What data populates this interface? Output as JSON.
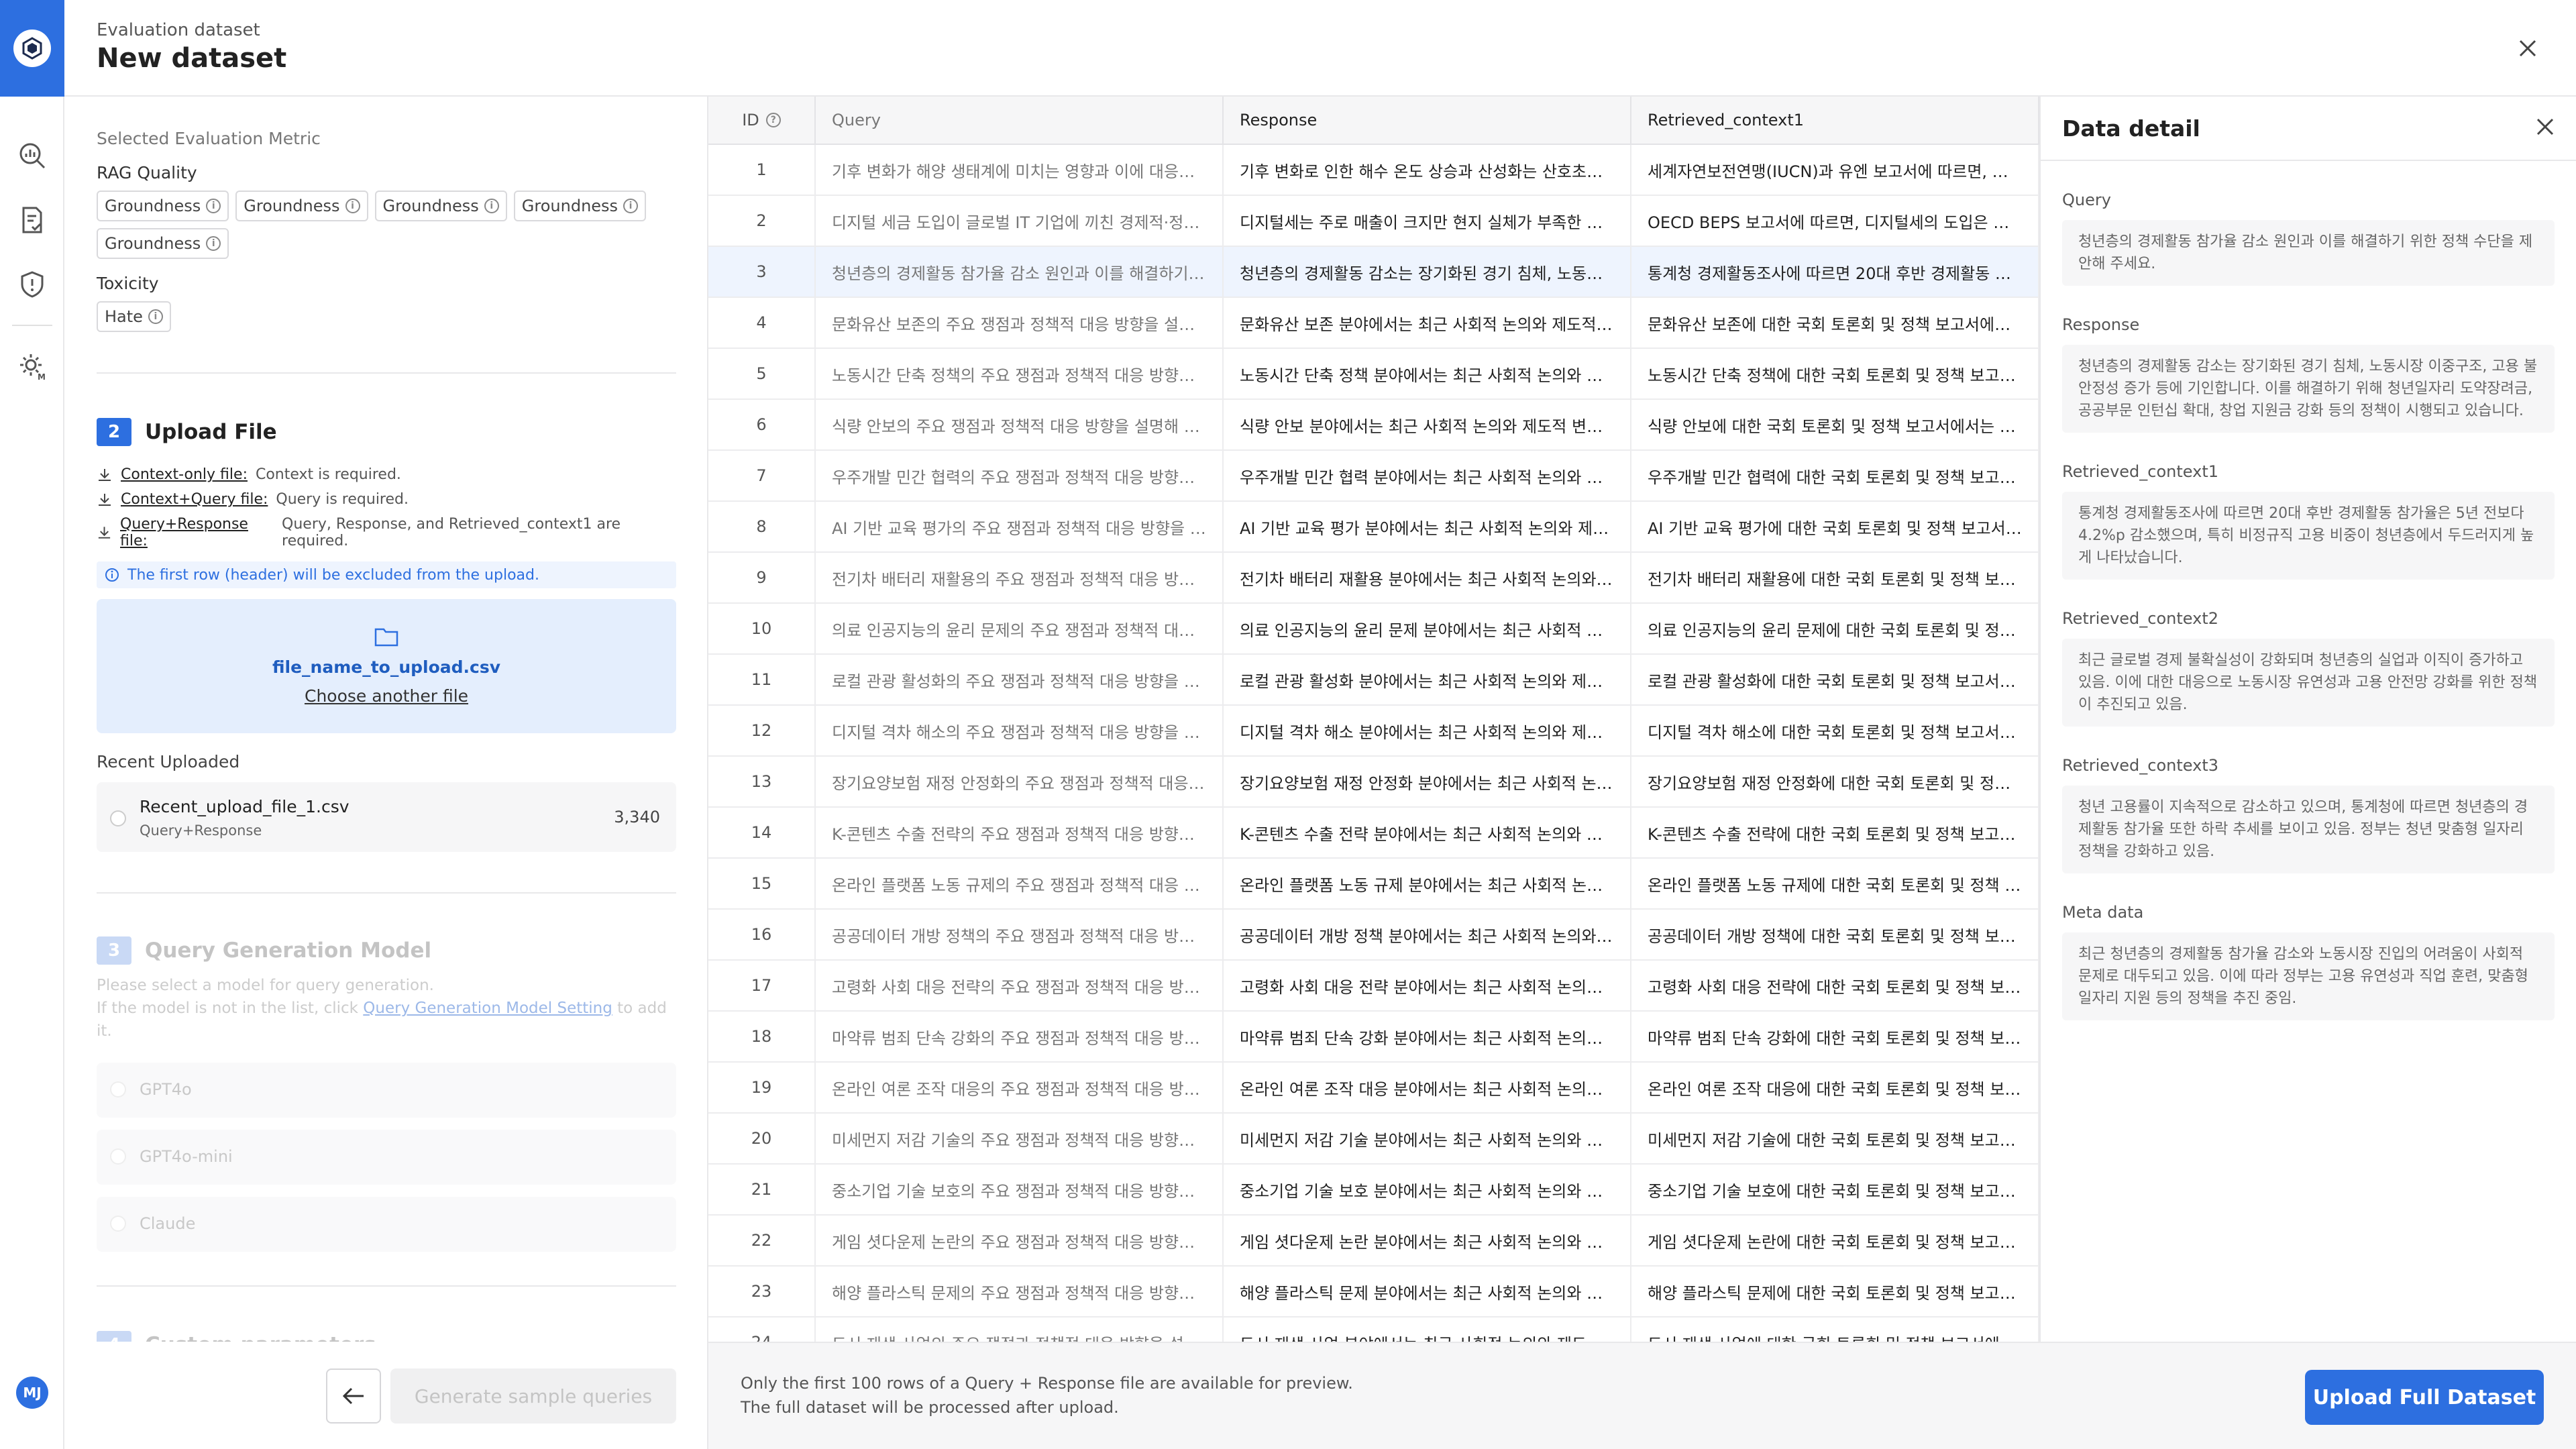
{
  "header": {
    "subtitle": "Evaluation dataset",
    "title": "New dataset"
  },
  "sidebar": {
    "avatar_initials": "MJ",
    "icons": [
      "analytics-icon",
      "document-check-icon",
      "shield-icon",
      "settings-model-icon"
    ]
  },
  "metrics": {
    "section_label": "Selected Evaluation Metric",
    "groups": [
      {
        "label": "RAG Quality",
        "chips": [
          "Groundness",
          "Groundness",
          "Groundness",
          "Groundness",
          "Groundness"
        ]
      },
      {
        "label": "Toxicity",
        "chips": [
          "Hate"
        ]
      }
    ]
  },
  "upload": {
    "step": "2",
    "title": "Upload File",
    "requirements": [
      {
        "link": "Context-only file:",
        "text": "Context is required."
      },
      {
        "link": "Context+Query file:",
        "text": "Query is required."
      },
      {
        "link": "Query+Response file:",
        "text": "Query, Response, and Retrieved_context1 are required."
      }
    ],
    "notice": "The first row (header) will be excluded from the upload.",
    "file_name": "file_name_to_upload.csv",
    "choose_another": "Choose another file",
    "recent_label": "Recent Uploaded",
    "recent": {
      "name": "Recent_upload_file_1.csv",
      "type": "Query+Response",
      "count": "3,340"
    }
  },
  "query_gen": {
    "step": "3",
    "title": "Query Generation Model",
    "desc1": "Please select a model for query generation.",
    "desc2_prefix": "If the model is not in the list, click ",
    "desc2_link": "Query Generation Model Setting",
    "desc2_suffix": " to add it.",
    "models": [
      "GPT4o",
      "GPT4o-mini",
      "Claude"
    ]
  },
  "custom": {
    "step": "4",
    "title": "Custom parameters"
  },
  "footer_left": {
    "generate_label": "Generate sample queries"
  },
  "table": {
    "columns": [
      "ID",
      "Query",
      "Response",
      "Retrieved_context1"
    ],
    "rows": [
      [
        "1",
        "기후 변화가 해양 생태계에 미치는 영향과 이에 대응하기 위한 정책",
        "기후 변화로 인한 해수 온도 상승과 산성화는 산호초의 백화를",
        "세계자연보전연맹(IUCN)과 유엔 보고서에 따르면, 해양 생태계"
      ],
      [
        "2",
        "디지털 세금 도입이 글로벌 IT 기업에 끼친 경제적·정책적 영향",
        "디지털세는 주로 매출이 크지만 현지 실체가 부족한 글로벌 기업",
        "OECD BEPS 보고서에 따르면, 디지털세의 도입은 다국적 기업"
      ],
      [
        "3",
        "청년층의 경제활동 참가율 감소 원인과 이를 해결하기 위한 정책",
        "청년층의 경제활동 감소는 장기화된 경기 침체, 노동시장 이중구조",
        "통계청 경제활동조사에 따르면 20대 후반 경제활동 참가율은"
      ],
      [
        "4",
        "문화유산 보존의 주요 쟁점과 정책적 대응 방향을 설명해 주세요",
        "문화유산 보존 분야에서는 최근 사회적 논의와 제도적 변화가",
        "문화유산 보존에 대한 국회 토론회 및 정책 보고서에서는"
      ],
      [
        "5",
        "노동시간 단축 정책의 주요 쟁점과 정책적 대응 방향을 설명해",
        "노동시간 단축 정책 분야에서는 최근 사회적 논의와 제도적",
        "노동시간 단축 정책에 대한 국회 토론회 및 정책 보고서에서는"
      ],
      [
        "6",
        "식량 안보의 주요 쟁점과 정책적 대응 방향을 설명해 주세요",
        "식량 안보 분야에서는 최근 사회적 논의와 제도적 변화가",
        "식량 안보에 대한 국회 토론회 및 정책 보고서에서는 관련"
      ],
      [
        "7",
        "우주개발 민간 협력의 주요 쟁점과 정책적 대응 방향을 설명해",
        "우주개발 민간 협력 분야에서는 최근 사회적 논의와 제도적",
        "우주개발 민간 협력에 대한 국회 토론회 및 정책 보고서에서는"
      ],
      [
        "8",
        "AI 기반 교육 평가의 주요 쟁점과 정책적 대응 방향을 설명해",
        "AI 기반 교육 평가 분야에서는 최근 사회적 논의와 제도적",
        "AI 기반 교육 평가에 대한 국회 토론회 및 정책 보고서에서는"
      ],
      [
        "9",
        "전기차 배터리 재활용의 주요 쟁점과 정책적 대응 방향을 설명해",
        "전기차 배터리 재활용 분야에서는 최근 사회적 논의와 제도적",
        "전기차 배터리 재활용에 대한 국회 토론회 및 정책 보고서에서는"
      ],
      [
        "10",
        "의료 인공지능의 윤리 문제의 주요 쟁점과 정책적 대응 방향을",
        "의료 인공지능의 윤리 문제 분야에서는 최근 사회적 논의와",
        "의료 인공지능의 윤리 문제에 대한 국회 토론회 및 정책 보고서"
      ],
      [
        "11",
        "로컬 관광 활성화의 주요 쟁점과 정책적 대응 방향을 설명해",
        "로컬 관광 활성화 분야에서는 최근 사회적 논의와 제도적 변화",
        "로컬 관광 활성화에 대한 국회 토론회 및 정책 보고서에서는"
      ],
      [
        "12",
        "디지털 격차 해소의 주요 쟁점과 정책적 대응 방향을 설명해",
        "디지털 격차 해소 분야에서는 최근 사회적 논의와 제도적 변화",
        "디지털 격차 해소에 대한 국회 토론회 및 정책 보고서에서는"
      ],
      [
        "13",
        "장기요양보험 재정 안정화의 주요 쟁점과 정책적 대응 방향을",
        "장기요양보험 재정 안정화 분야에서는 최근 사회적 논의와",
        "장기요양보험 재정 안정화에 대한 국회 토론회 및 정책 보고서"
      ],
      [
        "14",
        "K-콘텐츠 수출 전략의 주요 쟁점과 정책적 대응 방향을 설명해",
        "K-콘텐츠 수출 전략 분야에서는 최근 사회적 논의와 제도적",
        "K-콘텐츠 수출 전략에 대한 국회 토론회 및 정책 보고서에서는"
      ],
      [
        "15",
        "온라인 플랫폼 노동 규제의 주요 쟁점과 정책적 대응 방향을",
        "온라인 플랫폼 노동 규제 분야에서는 최근 사회적 논의와 제도적",
        "온라인 플랫폼 노동 규제에 대한 국회 토론회 및 정책 보고서"
      ],
      [
        "16",
        "공공데이터 개방 정책의 주요 쟁점과 정책적 대응 방향을 설명해",
        "공공데이터 개방 정책 분야에서는 최근 사회적 논의와 제도적",
        "공공데이터 개방 정책에 대한 국회 토론회 및 정책 보고서에서는"
      ],
      [
        "17",
        "고령화 사회 대응 전략의 주요 쟁점과 정책적 대응 방향을 설명해",
        "고령화 사회 대응 전략 분야에서는 최근 사회적 논의와 제도적",
        "고령화 사회 대응 전략에 대한 국회 토론회 및 정책 보고서에서는"
      ],
      [
        "18",
        "마약류 범죄 단속 강화의 주요 쟁점과 정책적 대응 방향을 설명해",
        "마약류 범죄 단속 강화 분야에서는 최근 사회적 논의와 제도적",
        "마약류 범죄 단속 강화에 대한 국회 토론회 및 정책 보고서에서는"
      ],
      [
        "19",
        "온라인 여론 조작 대응의 주요 쟁점과 정책적 대응 방향을 설명해",
        "온라인 여론 조작 대응 분야에서는 최근 사회적 논의와 제도적",
        "온라인 여론 조작 대응에 대한 국회 토론회 및 정책 보고서에서는"
      ],
      [
        "20",
        "미세먼지 저감 기술의 주요 쟁점과 정책적 대응 방향을 설명해",
        "미세먼지 저감 기술 분야에서는 최근 사회적 논의와 제도적",
        "미세먼지 저감 기술에 대한 국회 토론회 및 정책 보고서에서는"
      ],
      [
        "21",
        "중소기업 기술 보호의 주요 쟁점과 정책적 대응 방향을 설명해",
        "중소기업 기술 보호 분야에서는 최근 사회적 논의와 제도적",
        "중소기업 기술 보호에 대한 국회 토론회 및 정책 보고서에서는"
      ],
      [
        "22",
        "게임 셧다운제 논란의 주요 쟁점과 정책적 대응 방향을 설명해",
        "게임 셧다운제 논란 분야에서는 최근 사회적 논의와 제도적",
        "게임 셧다운제 논란에 대한 국회 토론회 및 정책 보고서에서는"
      ],
      [
        "23",
        "해양 플라스틱 문제의 주요 쟁점과 정책적 대응 방향을 설명해",
        "해양 플라스틱 문제 분야에서는 최근 사회적 논의와 제도적",
        "해양 플라스틱 문제에 대한 국회 토론회 및 정책 보고서에서는"
      ],
      [
        "24",
        "도시 재생 사업의 주요 쟁점과 정책적 대응 방향을 설명해 주세요",
        "도시 재생 사업 분야에서는 최근 사회적 논의와 제도적 변화가",
        "도시 재생 사업에 대한 국회 토론회 및 정책 보고서에서는"
      ]
    ],
    "selected_row": 3
  },
  "footer_mid": {
    "note1": "Only the first 100 rows of a Query + Response file are available for preview.",
    "note2": "The full dataset will be processed after upload.",
    "upload_label": "Upload Full Dataset"
  },
  "detail": {
    "title": "Data detail",
    "fields": [
      {
        "label": "Query",
        "value": "청년층의 경제활동 참가율 감소 원인과 이를 해결하기 위한 정책 수단을 제안해 주세요."
      },
      {
        "label": "Response",
        "value": "청년층의 경제활동 감소는 장기화된 경기 침체, 노동시장 이중구조, 고용 불안정성 증가 등에 기인합니다. 이를 해결하기 위해 청년일자리 도약장려금, 공공부문 인턴십 확대, 창업 지원금 강화 등의 정책이 시행되고 있습니다."
      },
      {
        "label": "Retrieved_context1",
        "value": "통계청 경제활동조사에 따르면 20대 후반 경제활동 참가율은 5년 전보다 4.2%p 감소했으며, 특히 비정규직 고용 비중이 청년층에서 두드러지게 높게 나타났습니다."
      },
      {
        "label": "Retrieved_context2",
        "value": "최근 글로벌 경제 불확실성이 강화되며 청년층의 실업과 이직이 증가하고 있음. 이에 대한 대응으로 노동시장 유연성과 고용 안전망 강화를 위한 정책이 추진되고 있음."
      },
      {
        "label": "Retrieved_context3",
        "value": "청년 고용률이 지속적으로 감소하고 있으며, 통계청에 따르면 청년층의 경제활동 참가율 또한 하락 추세를 보이고 있음. 정부는 청년 맞춤형 일자리 정책을 강화하고 있음."
      },
      {
        "label": "Meta data",
        "value": "최근 청년층의 경제활동 참가율 감소와 노동시장 진입의 어려움이 사회적 문제로 대두되고 있음. 이에 따라 정부는 고용 유연성과 직업 훈련, 맞춤형 일자리 지원 등의 정책을 추진 중임."
      }
    ]
  }
}
